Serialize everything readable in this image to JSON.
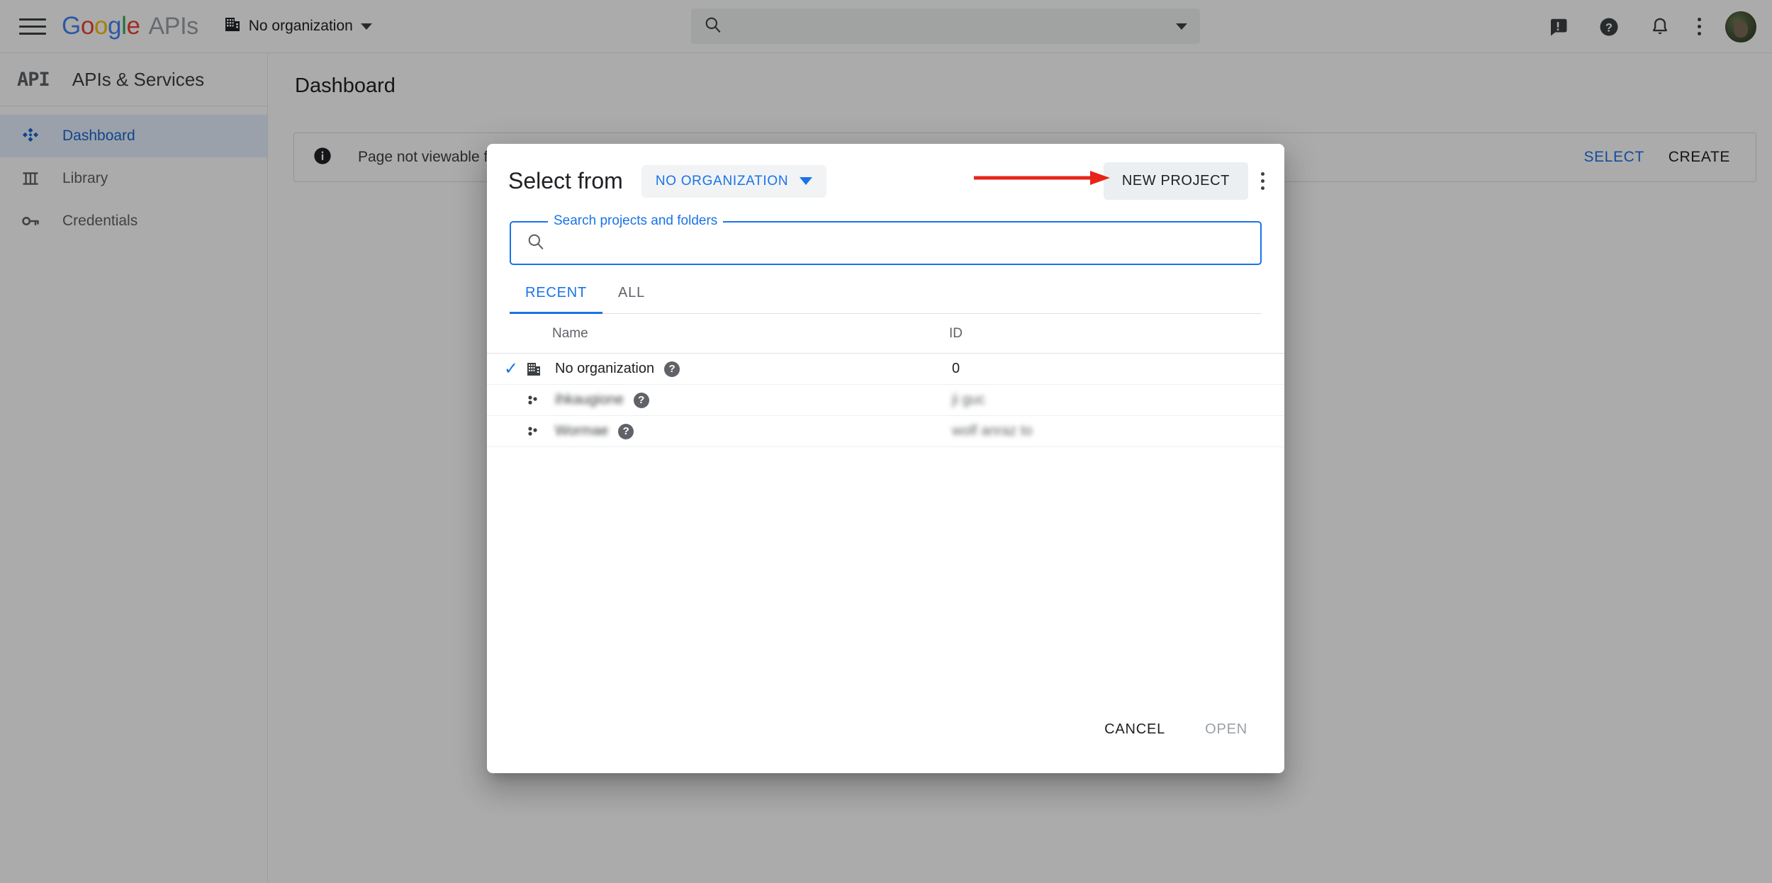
{
  "header": {
    "menu_icon": "hamburger-menu-icon",
    "brand": {
      "g1": "G",
      "o1": "o",
      "o2": "o",
      "g2": "g",
      "l": "l",
      "e": "e",
      "suffix": "APIs"
    },
    "org_switcher": {
      "icon": "organization-building-icon",
      "label": "No organization",
      "caret": "chevron-down-icon"
    },
    "search": {
      "icon": "search-icon",
      "value": "",
      "placeholder": "",
      "caret": "chevron-down-icon"
    },
    "icons": [
      {
        "name": "feedback-icon",
        "glyph": "!"
      },
      {
        "name": "help-icon",
        "glyph": "?"
      },
      {
        "name": "notifications-bell-icon",
        "glyph": "bell"
      },
      {
        "name": "more-options-icon",
        "glyph": "kebab"
      }
    ],
    "avatar": "user-avatar"
  },
  "sidebar": {
    "logo_text": "API",
    "title": "APIs & Services",
    "items": [
      {
        "label": "Dashboard",
        "icon": "dashboard-icon",
        "active": true
      },
      {
        "label": "Library",
        "icon": "library-icon",
        "active": false
      },
      {
        "label": "Credentials",
        "icon": "key-icon",
        "active": false
      }
    ]
  },
  "main": {
    "page_title": "Dashboard",
    "banner": {
      "icon": "info-icon",
      "message": "Page not viewable f",
      "actions": [
        {
          "label": "SELECT",
          "style": "primary"
        },
        {
          "label": "CREATE",
          "style": "default"
        }
      ]
    }
  },
  "dialog": {
    "title": "Select from",
    "org_chip": {
      "label": "NO ORGANIZATION",
      "caret": "chevron-down-icon"
    },
    "new_project_button": "NEW PROJECT",
    "overflow_menu": "more-options-icon",
    "search": {
      "legend": "Search projects and folders",
      "icon": "search-icon",
      "value": "",
      "placeholder": ""
    },
    "tabs": [
      {
        "label": "RECENT",
        "active": true
      },
      {
        "label": "ALL",
        "active": false
      }
    ],
    "table": {
      "columns": [
        "Name",
        "ID"
      ],
      "rows": [
        {
          "selected": true,
          "icon": "organization-building-icon",
          "name": "No organization",
          "help": "?",
          "id": "0",
          "redacted": false
        },
        {
          "selected": false,
          "icon": "project-icon",
          "name": "ihkaugione",
          "help": "?",
          "id": "ji    guc",
          "redacted": true
        },
        {
          "selected": false,
          "icon": "project-icon",
          "name": "Wormae",
          "help": "?",
          "id": "wolf  anraz to",
          "redacted": true
        }
      ]
    },
    "footer": {
      "cancel": "CANCEL",
      "open": "OPEN"
    }
  },
  "annotation": {
    "arrow": {
      "color": "#e8241a",
      "points_to": "NEW PROJECT"
    }
  },
  "colors": {
    "accent_blue": "#1a73e8",
    "selected_nav_bg": "#e8f0fe",
    "annotation_red": "#e8241a",
    "chip_bg": "#f1f3f4",
    "button_bg": "#eceff1"
  }
}
